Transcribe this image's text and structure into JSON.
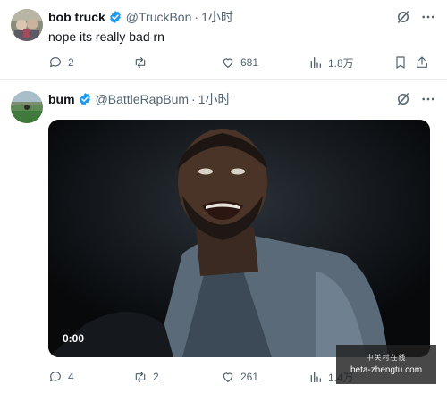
{
  "posts": [
    {
      "display_name": "bob truck",
      "handle": "@TruckBon",
      "separator": "·",
      "time": "1小时",
      "text": "nope its really bad rn",
      "verified": true,
      "stats": {
        "replies": "2",
        "retweets": "",
        "likes": "681",
        "views": "1.8万"
      }
    },
    {
      "display_name": "bum",
      "handle": "@BattleRapBum",
      "separator": "·",
      "time": "1小时",
      "verified": true,
      "video": {
        "timestamp": "0:00"
      },
      "stats": {
        "replies": "4",
        "retweets": "2",
        "likes": "261",
        "views": "1.4万"
      }
    }
  ],
  "watermark": {
    "top": "中关村在线",
    "bottom": "beta-zhengtu.com"
  },
  "colors": {
    "verified": "#1d9bf0",
    "muted": "#536471",
    "text": "#0f1419"
  }
}
